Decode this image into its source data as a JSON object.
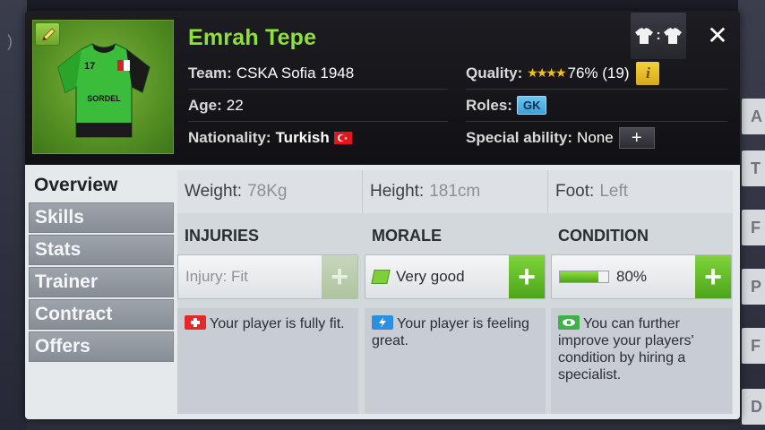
{
  "player": {
    "name": "Emrah Tepe",
    "jersey_number": "17",
    "jersey_sponsor": "SORDEL"
  },
  "info": {
    "team_label": "Team:",
    "team_value": "CSKA Sofia 1948",
    "age_label": "Age:",
    "age_value": "22",
    "nationality_label": "Nationality:",
    "nationality_value": "Turkish",
    "quality_label": "Quality:",
    "quality_stars": "★★★★",
    "quality_value": "76% (19)",
    "roles_label": "Roles:",
    "roles_value": "GK",
    "special_label": "Special ability:",
    "special_value": "None"
  },
  "header_buttons": {
    "kit_colon": ":",
    "close": "✕",
    "info": "i",
    "plus": "+"
  },
  "tabs": [
    {
      "label": "Overview",
      "active": true
    },
    {
      "label": "Skills",
      "active": false
    },
    {
      "label": "Stats",
      "active": false
    },
    {
      "label": "Trainer",
      "active": false
    },
    {
      "label": "Contract",
      "active": false
    },
    {
      "label": "Offers",
      "active": false
    }
  ],
  "attributes": {
    "weight_label": "Weight:",
    "weight_value": "78Kg",
    "height_label": "Height:",
    "height_value": "181cm",
    "foot_label": "Foot:",
    "foot_value": "Left"
  },
  "injuries": {
    "title": "INJURIES",
    "status": "Injury: Fit",
    "description": "Your player is fully fit."
  },
  "morale": {
    "title": "MORALE",
    "status": "Very good",
    "description": "Your player is feeling great."
  },
  "condition": {
    "title": "CONDITION",
    "status": "80%",
    "progress": 0.8,
    "description": "You can further improve your players' condition by hiring a specialist."
  },
  "background": {
    "right_letters": [
      "A",
      "T",
      "F",
      "P",
      "F",
      "D"
    ]
  },
  "colors": {
    "name_green": "#8ee03a",
    "accent_green": "#4ea51a",
    "role_blue": "#3aa0d9",
    "info_yellow": "#d8a91a"
  }
}
